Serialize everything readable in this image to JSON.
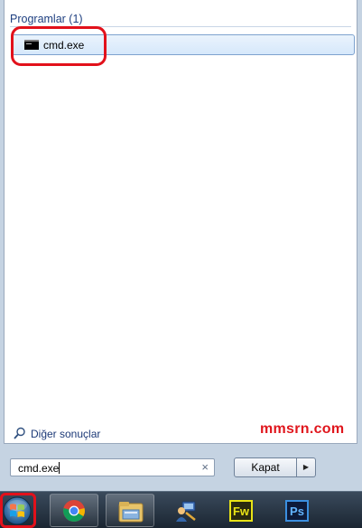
{
  "results": {
    "section_header": "Programlar (1)",
    "items": [
      {
        "label": "cmd.exe",
        "icon": "command-prompt-icon"
      }
    ],
    "more_results_label": "Diğer sonuçlar"
  },
  "watermark": "mmsrn.com",
  "search": {
    "value": "cmd.exe",
    "clear_glyph": "×"
  },
  "shutdown": {
    "label": "Kapat",
    "arrow_glyph": "▶"
  },
  "taskbar": {
    "pinned": [
      {
        "name": "chrome",
        "icon": "chrome-icon",
        "active": true
      },
      {
        "name": "windows-explorer",
        "icon": "folder-icon",
        "active": true
      },
      {
        "name": "program",
        "icon": "program-icon",
        "active": false
      },
      {
        "name": "fireworks",
        "icon": "fireworks-icon",
        "text": "Fw",
        "active": false
      },
      {
        "name": "photoshop",
        "icon": "photoshop-icon",
        "text": "Ps",
        "active": false
      }
    ]
  },
  "colors": {
    "highlight_ring": "#e2111b",
    "watermark": "#e0161d",
    "link": "#1c3977",
    "header": "#1e3f80"
  }
}
